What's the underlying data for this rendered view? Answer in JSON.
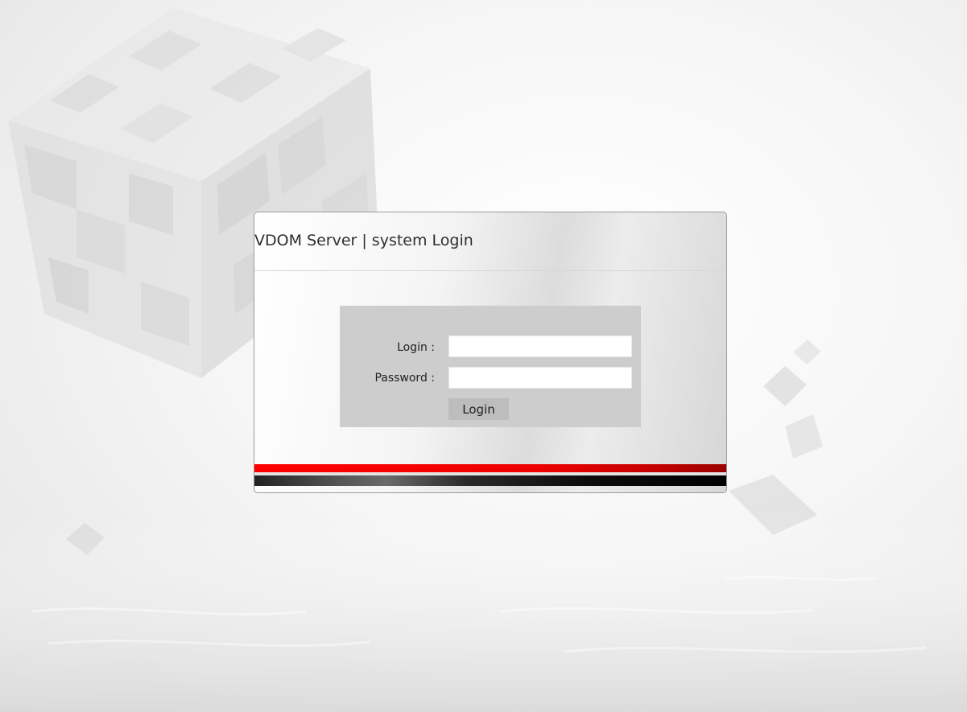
{
  "window": {
    "title": "VDOM Server | system Login"
  },
  "login_form": {
    "login_label": "Login :",
    "login_value": "",
    "password_label": "Password :",
    "password_value": "",
    "submit_label": "Login"
  },
  "colors": {
    "accent_red": "#ff0000",
    "accent_dark": "#000000",
    "form_background": "#cdcdcd",
    "button_background": "#bdbdbd"
  }
}
